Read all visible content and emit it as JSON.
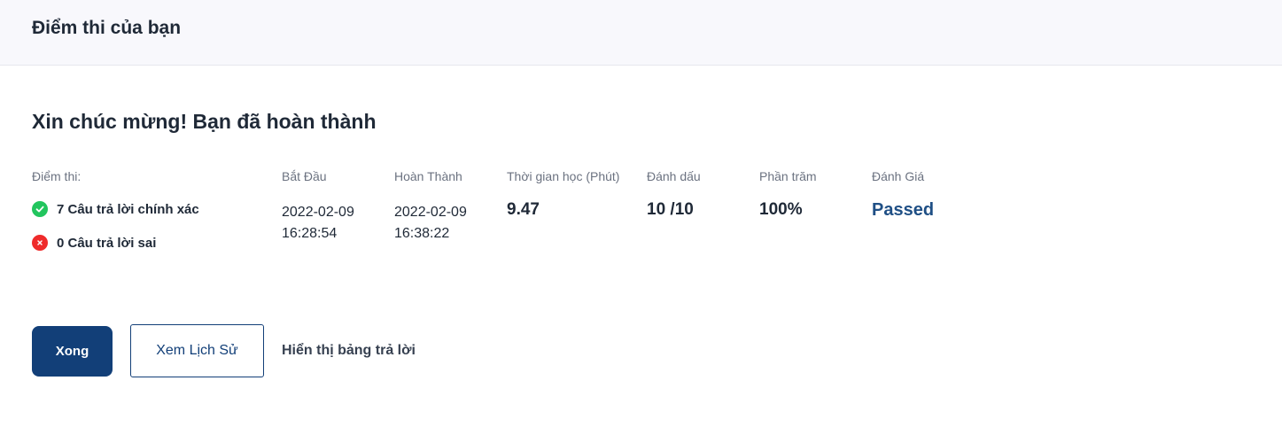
{
  "header": {
    "title": "Điểm thi của bạn"
  },
  "result": {
    "heading": "Xin chúc mừng! Bạn đã hoàn thành",
    "score": {
      "label": "Điểm thi:",
      "correct_text": "7 Câu trả lời chính xác",
      "wrong_text": "0 Câu trả lời sai"
    },
    "start": {
      "label": "Bắt Đầu",
      "date": "2022-02-09",
      "time": "16:28:54"
    },
    "finish": {
      "label": "Hoàn Thành",
      "date": "2022-02-09",
      "time": "16:38:22"
    },
    "duration": {
      "label": "Thời gian học (Phút)",
      "value": "9.47"
    },
    "marks": {
      "label": "Đánh dấu",
      "value": "10 /10"
    },
    "percent": {
      "label": "Phần trăm",
      "value": "100%"
    },
    "evaluation": {
      "label": "Đánh Giá",
      "value": "Passed"
    }
  },
  "actions": {
    "done_label": "Xong",
    "history_label": "Xem Lịch Sử",
    "show_answers_label": "Hiển thị bảng trả lời"
  },
  "colors": {
    "primary": "#123f78",
    "passed": "#1f4f85",
    "correct": "#22c55e",
    "wrong": "#ef2b2b",
    "header_bg": "#f8f8fc"
  },
  "icons": {
    "correct": "check-circle-icon",
    "wrong": "x-circle-icon"
  }
}
